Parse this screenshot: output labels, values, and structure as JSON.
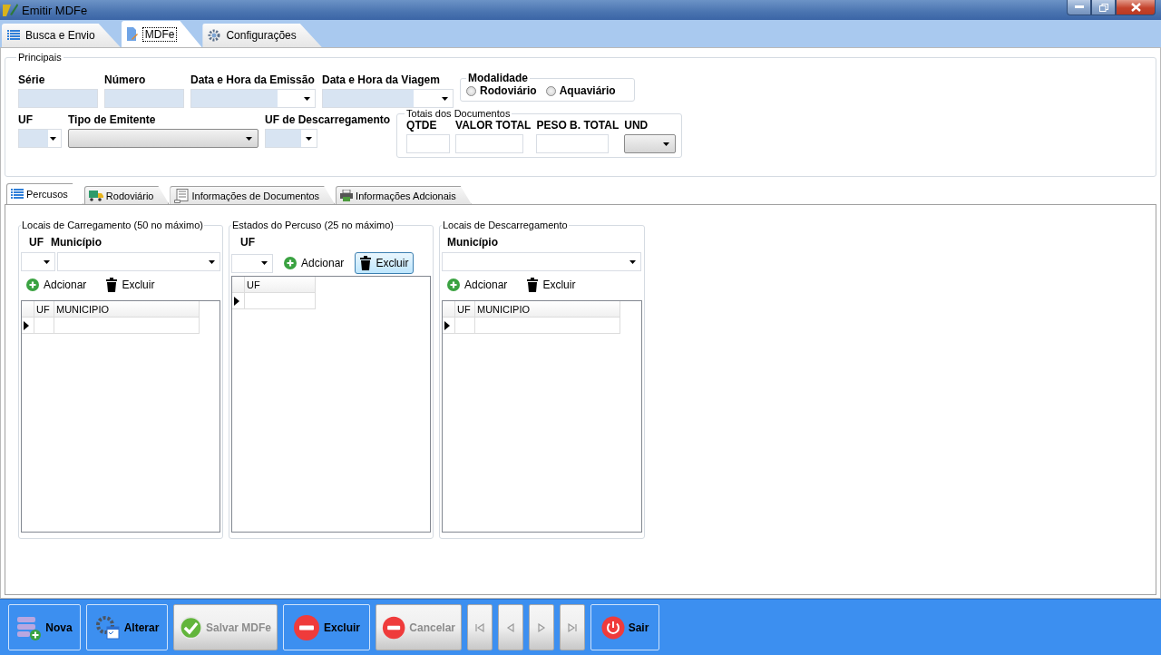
{
  "window": {
    "title": "Emitir MDFe"
  },
  "main_tabs": [
    {
      "label": "Busca e Envio",
      "selected": false
    },
    {
      "label": "MDFe",
      "selected": true
    },
    {
      "label": "Configurações",
      "selected": false
    }
  ],
  "principais": {
    "title": "Principais",
    "row_1": [
      {
        "label": "Série",
        "kind": "text"
      },
      {
        "label": "Número",
        "kind": "text"
      },
      {
        "label": "Data e Hora da Emissão",
        "kind": "combo"
      },
      {
        "label": "Data e Hora da Viagem",
        "kind": "combo"
      }
    ],
    "modalidade": {
      "title": "Modalidade",
      "options": [
        {
          "label": "Rodoviário",
          "selected": false
        },
        {
          "label": "Aquaviário",
          "selected": false
        }
      ]
    },
    "row_2": [
      {
        "label": "UF",
        "kind": "small-combo"
      },
      {
        "label": "Tipo de Emitente",
        "kind": "button-combo"
      },
      {
        "label": "UF de Descarregamento",
        "kind": "small-combo"
      }
    ],
    "totais": {
      "title": "Totais dos Documentos",
      "fields": [
        {
          "label": "QTDE",
          "kind": "text"
        },
        {
          "label": "VALOR TOTAL",
          "kind": "text"
        },
        {
          "label": "PESO B. TOTAL",
          "kind": "text"
        },
        {
          "label": "UND",
          "kind": "button-combo"
        }
      ]
    }
  },
  "sub_tabs": [
    {
      "label": "Percusos",
      "selected": true
    },
    {
      "label": "Rodoviário",
      "selected": false
    },
    {
      "label": "Informações de Documentos",
      "selected": false
    },
    {
      "label": "Informações Adcionais",
      "selected": false
    }
  ],
  "groups": [
    {
      "title": "Locais de Carregamento (50 no máximo)",
      "fields": [
        "UF",
        "Município"
      ],
      "buttons": [
        {
          "label": "Adcionar",
          "focused": false
        },
        {
          "label": "Excluir",
          "focused": false
        }
      ],
      "grid_columns": [
        "UF",
        "MUNICIPIO"
      ]
    },
    {
      "title": "Estados do Percuso (25 no máximo)",
      "fields": [
        "UF"
      ],
      "buttons": [
        {
          "label": "Adcionar",
          "focused": false
        },
        {
          "label": "Excluir",
          "focused": true
        }
      ],
      "grid_columns": [
        "UF"
      ]
    },
    {
      "title": "Locais de Descarregamento",
      "fields": [
        "Município"
      ],
      "buttons": [
        {
          "label": "Adcionar",
          "focused": false
        },
        {
          "label": "Excluir",
          "focused": false
        }
      ],
      "grid_columns": [
        "UF",
        "MUNICIPIO"
      ]
    }
  ],
  "toolbar": [
    {
      "kind": "action",
      "label": "Nova",
      "disabled": false
    },
    {
      "kind": "action",
      "label": "Alterar",
      "disabled": false
    },
    {
      "kind": "action",
      "label": "Salvar MDFe",
      "disabled": true
    },
    {
      "kind": "action",
      "label": "Excluir",
      "disabled": false
    },
    {
      "kind": "action",
      "label": "Cancelar",
      "disabled": true
    },
    {
      "kind": "nav",
      "disabled": true
    },
    {
      "kind": "nav",
      "disabled": true
    },
    {
      "kind": "nav",
      "disabled": true
    },
    {
      "kind": "nav",
      "disabled": true
    },
    {
      "kind": "action",
      "label": "Sair",
      "disabled": false
    }
  ]
}
